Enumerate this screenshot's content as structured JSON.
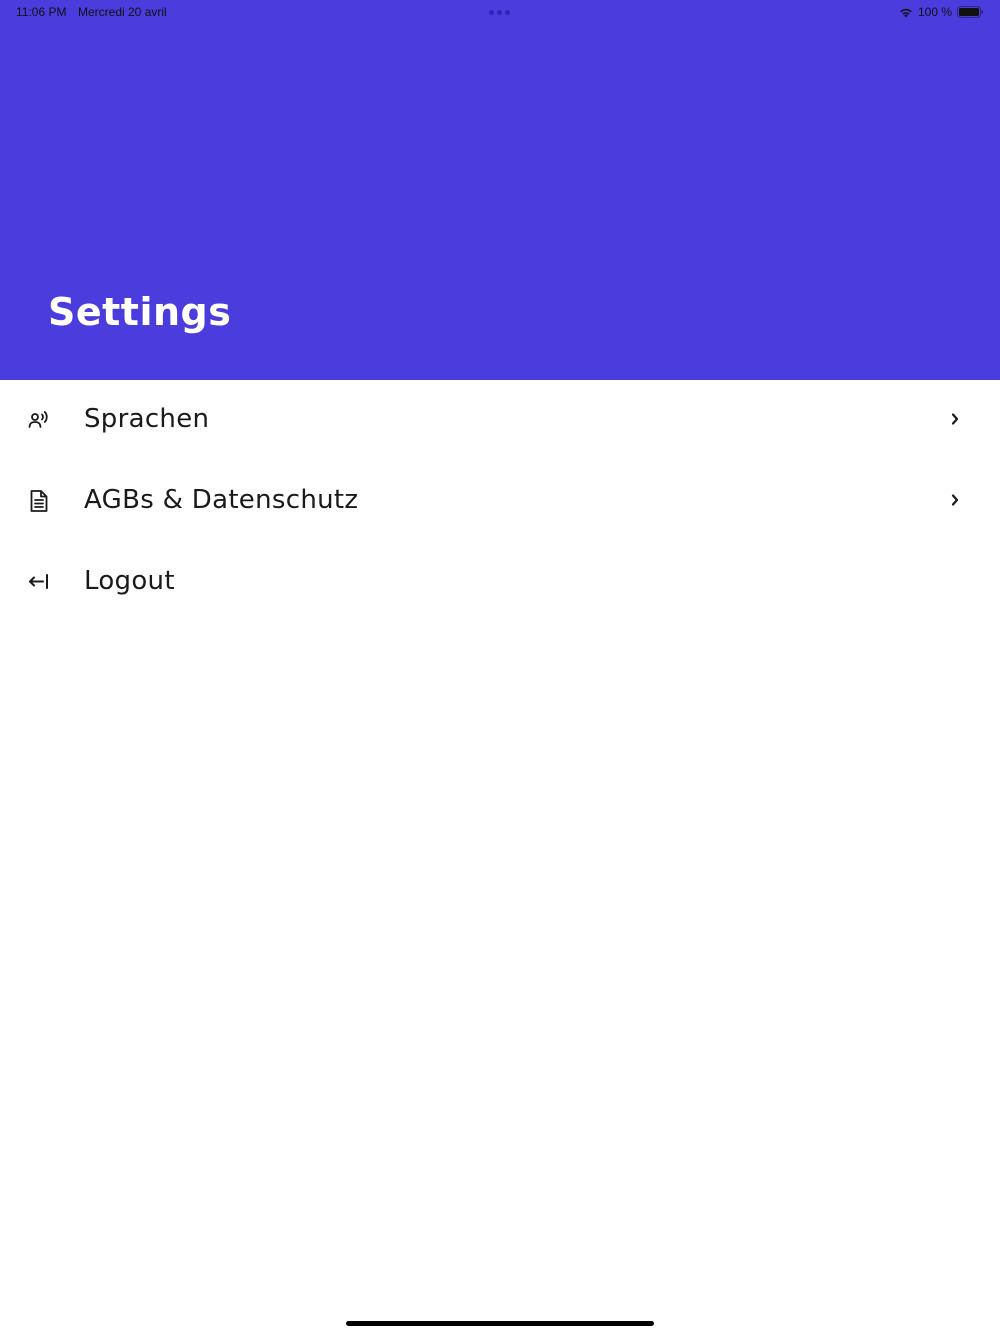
{
  "status_bar": {
    "time": "11:06 PM",
    "date": "Mercredi 20 avril",
    "battery_percent": "100 %",
    "battery_level": 1.0,
    "icons": [
      "wifi-icon",
      "battery-icon"
    ]
  },
  "header": {
    "title": "Settings",
    "background_color": "#4a3cdd"
  },
  "settings": {
    "items": [
      {
        "label": "Sprachen",
        "icon": "voice-language-icon",
        "has_chevron": true
      },
      {
        "label": "AGBs & Datenschutz",
        "icon": "document-icon",
        "has_chevron": true
      },
      {
        "label": "Logout",
        "icon": "logout-icon",
        "has_chevron": false
      }
    ]
  }
}
